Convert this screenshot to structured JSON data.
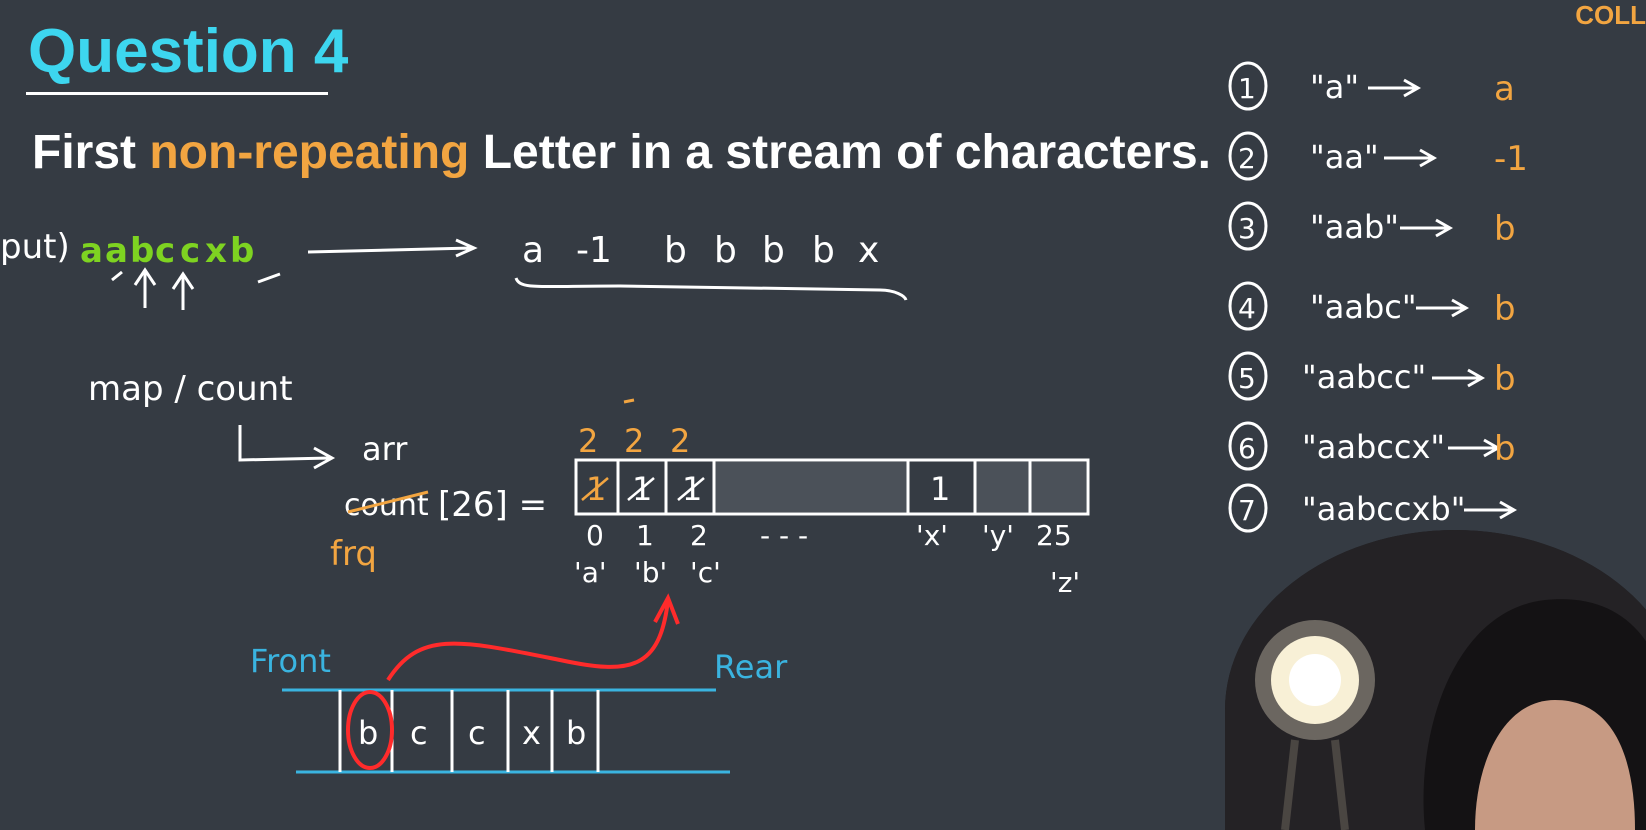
{
  "header": {
    "title": "Question 4",
    "subtitle_part1": "First ",
    "subtitle_highlight": "non-repeating",
    "subtitle_part2": " Letter in a stream of characters.",
    "logo_text": "COLL"
  },
  "colors": {
    "background": "#353b43",
    "title": "#3dd6ef",
    "highlight": "#f2a541",
    "green_input": "#7ed321",
    "queue_line": "#3ab4e0",
    "red_arrow": "#ff2b2b"
  },
  "input_row": {
    "label": "put)",
    "stream": [
      "a",
      "a",
      "b",
      "c",
      "c",
      "x",
      "b"
    ],
    "output": [
      "a",
      "-1",
      "b",
      "b",
      "b",
      "b",
      "x"
    ]
  },
  "notes": {
    "map_count": "map / count",
    "arr": "arr",
    "count_struck": "count",
    "count_expr": "[26] =",
    "frq": "frq"
  },
  "count_array": {
    "cells": [
      "1",
      "1",
      "1",
      "",
      "1",
      "",
      ""
    ],
    "overwrite": [
      "2",
      "2",
      "2"
    ],
    "indices": [
      "0",
      "1",
      "2",
      "- - -",
      "'x'",
      "'y'",
      "25"
    ],
    "char_labels": [
      "'a'",
      "'b'",
      "'c'",
      "'z'"
    ]
  },
  "queue": {
    "front_label": "Front",
    "rear_label": "Rear",
    "items": [
      "b",
      "c",
      "c",
      "x",
      "b"
    ]
  },
  "examples": [
    {
      "num": "1",
      "input": "\"a\"",
      "result": "a"
    },
    {
      "num": "2",
      "input": "\"aa\"",
      "result": "-1"
    },
    {
      "num": "3",
      "input": "\"aab\"",
      "result": "b"
    },
    {
      "num": "4",
      "input": "\"aabc\"",
      "result": "b"
    },
    {
      "num": "5",
      "input": "\"aabcc\"",
      "result": "b"
    },
    {
      "num": "6",
      "input": "\"aabccx\"",
      "result": "b"
    },
    {
      "num": "7",
      "input": "\"aabccxb\"",
      "result": ""
    }
  ]
}
